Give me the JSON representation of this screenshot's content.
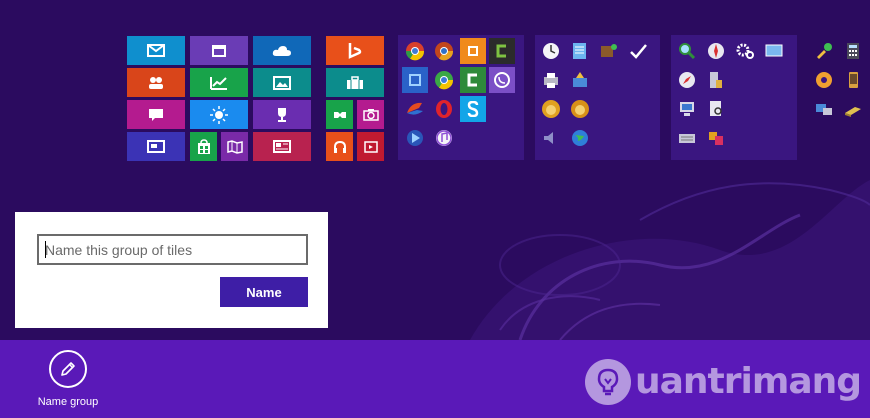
{
  "dialog": {
    "input_placeholder": "Name this group of tiles",
    "input_value": "",
    "name_button_label": "Name"
  },
  "app_bar": {
    "name_group_label": "Name group",
    "name_group_icon": "pencil-icon"
  },
  "watermark": {
    "text": "uantrimang",
    "icon": "lightbulb-icon"
  },
  "colors": {
    "background": "#2b0b5f",
    "app_bar": "#5a19b8",
    "button": "#3e1ea6",
    "group_panel": "#3a1680"
  },
  "tiles": {
    "group1": [
      "mail-tile",
      "calendar-tile",
      "onedrive-tile",
      "people-tile",
      "finance-tile",
      "photos-tile",
      "messaging-tile",
      "weather-tile",
      "sports-tile",
      "desktop-tile",
      "store-tile",
      "maps-tile",
      "news-tile"
    ],
    "group2": [
      "bing-tile",
      "travel-tile",
      "games-tile",
      "camera-tile",
      "music-tile",
      "video-tile"
    ],
    "group3": [
      "chrome-tile",
      "chrome-alt-tile",
      "app-orange-tile",
      "camtasia-tile",
      "app-blue-tile",
      "chrome-canary-tile",
      "camtasia-green-tile",
      "viber-tile",
      "office-tile",
      "opera-tile",
      "skype-tile",
      "media-player-tile",
      "itunes-tile"
    ],
    "group4": [
      "clock-tile",
      "notepad-tile",
      "paint-tile",
      "check-tile",
      "printer-tile",
      "tools-tile",
      "lion-tile",
      "lion2-tile",
      "speaker-tile",
      "globe-tile"
    ],
    "group5": [
      "magnifier-tile",
      "compass-tile",
      "settings-tile",
      "display-tile",
      "safari-tile",
      "cabinet-tile",
      "monitor-tile",
      "search-doc-tile",
      "keyboard-tile",
      "app-multi-tile"
    ],
    "group6": [
      "paint-app-tile",
      "calculator-tile",
      "cd-tile",
      "phone-tile",
      "network-tile",
      "tool-tile"
    ]
  }
}
